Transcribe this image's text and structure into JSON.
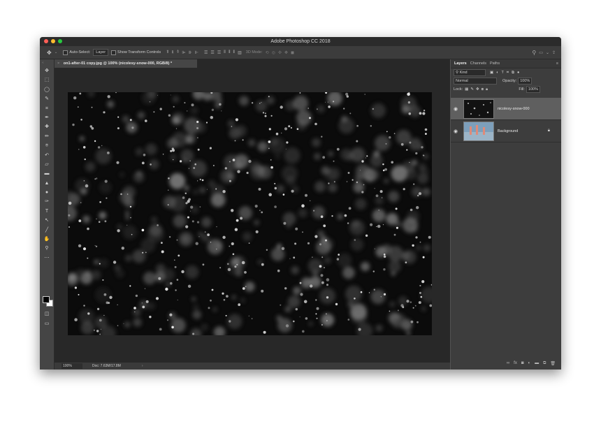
{
  "window": {
    "title": "Adobe Photoshop CC 2018"
  },
  "options_bar": {
    "move_icon": "move-icon",
    "auto_select_label": "Auto-Select:",
    "auto_select_value": "Layer",
    "show_transform_label": "Show Transform Controls",
    "mode_3d_label": "3D Mode:"
  },
  "tools": [
    "move-tool",
    "marquee-tool",
    "lasso-tool",
    "quick-select-tool",
    "crop-tool",
    "eyedropper-tool",
    "healing-tool",
    "brush-tool",
    "clone-stamp-tool",
    "history-brush-tool",
    "eraser-tool",
    "gradient-tool",
    "blur-tool",
    "dodge-tool",
    "pen-tool",
    "type-tool",
    "path-select-tool",
    "line-tool",
    "hand-tool",
    "zoom-tool",
    "more-tools"
  ],
  "tool_glyphs": [
    "✥",
    "⬚",
    "◯",
    "✎",
    "⌗",
    "✒",
    "✚",
    "✏",
    "⍟",
    "↶",
    "▱",
    "▬",
    "▲",
    "●",
    "✑",
    "T",
    "↖",
    "╱",
    "✋",
    "⚲",
    "⋯"
  ],
  "document": {
    "tab_title": "on1-after-01 copy.jpg @ 100% (nicolesy-snow-000, RGB/8) *",
    "zoom": "100%",
    "doc_size": "Doc: 7.63M/17.8M"
  },
  "layers_panel": {
    "tabs": [
      "Layers",
      "Channels",
      "Paths"
    ],
    "filter_label": "Kind",
    "blend_mode": "Normal",
    "opacity_label": "Opacity:",
    "opacity_value": "100%",
    "lock_label": "Lock:",
    "fill_label": "Fill:",
    "fill_value": "100%",
    "layers": [
      {
        "name": "nicolesy-snow-000",
        "selected": true
      },
      {
        "name": "Background",
        "selected": false,
        "locked": true
      }
    ]
  },
  "colors": {
    "chrome_bg": "#535353",
    "panel_bg": "#3d3d3d",
    "selected_layer": "#5f5f5f",
    "canvas": "#0b0b0b"
  }
}
